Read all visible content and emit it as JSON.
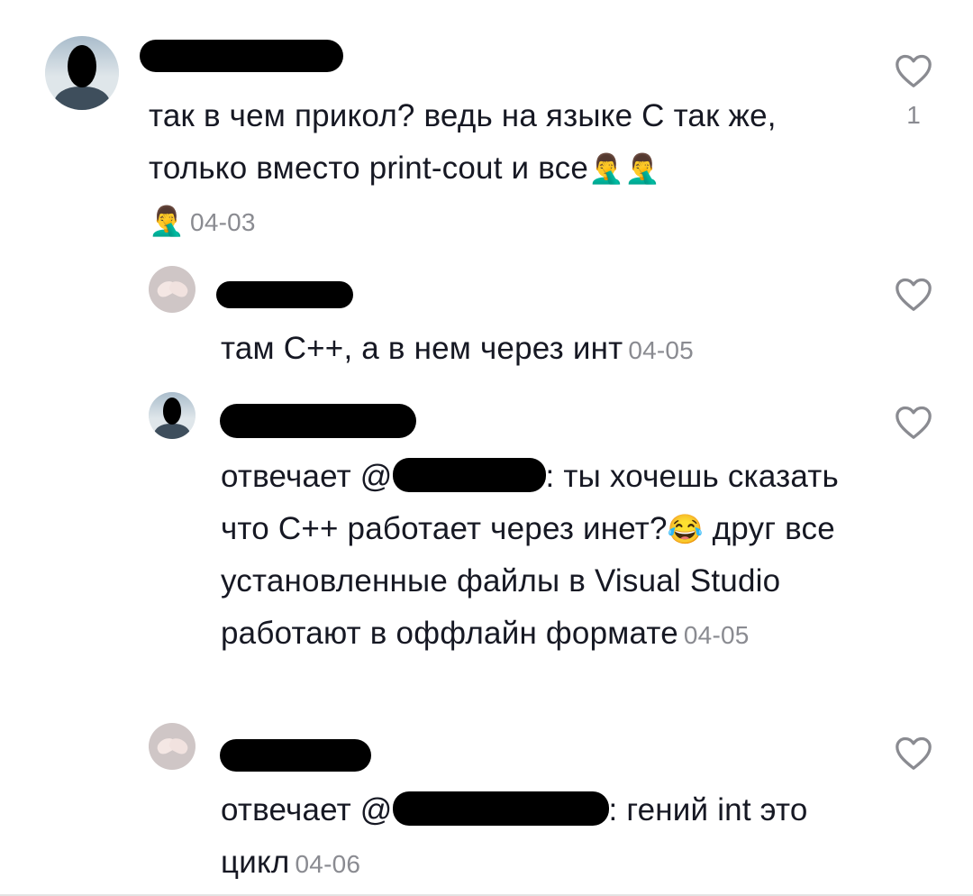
{
  "comments": [
    {
      "text": "так в чем прикол? ведь на языке С так же, только вместо print-cout и все",
      "emoji_inline": "🤦‍♂️🤦‍♂️",
      "emoji_next": "🤦‍♂️",
      "date": "04-03",
      "likes": "1",
      "avatar": "user-photo",
      "replies": [
        {
          "text": "там С++, а в нем через инт",
          "date": "04-05",
          "avatar": "heart-hands"
        },
        {
          "prefix": "отвечает @",
          "after_mention": ": ты хочешь сказать что С++ работает через инет?",
          "emoji": "😂",
          "text_tail": " друг все установленные файлы в Visual Studio работают в оффлайн формате",
          "date": "04-05",
          "avatar": "user-photo"
        },
        {
          "prefix": "отвечает @",
          "after_mention": ": гений int это цикл",
          "date": "04-06",
          "avatar": "heart-hands"
        }
      ]
    }
  ],
  "icons": {
    "like": "heart-outline-icon"
  },
  "colors": {
    "text": "#161823",
    "meta": "#8a8b91"
  }
}
